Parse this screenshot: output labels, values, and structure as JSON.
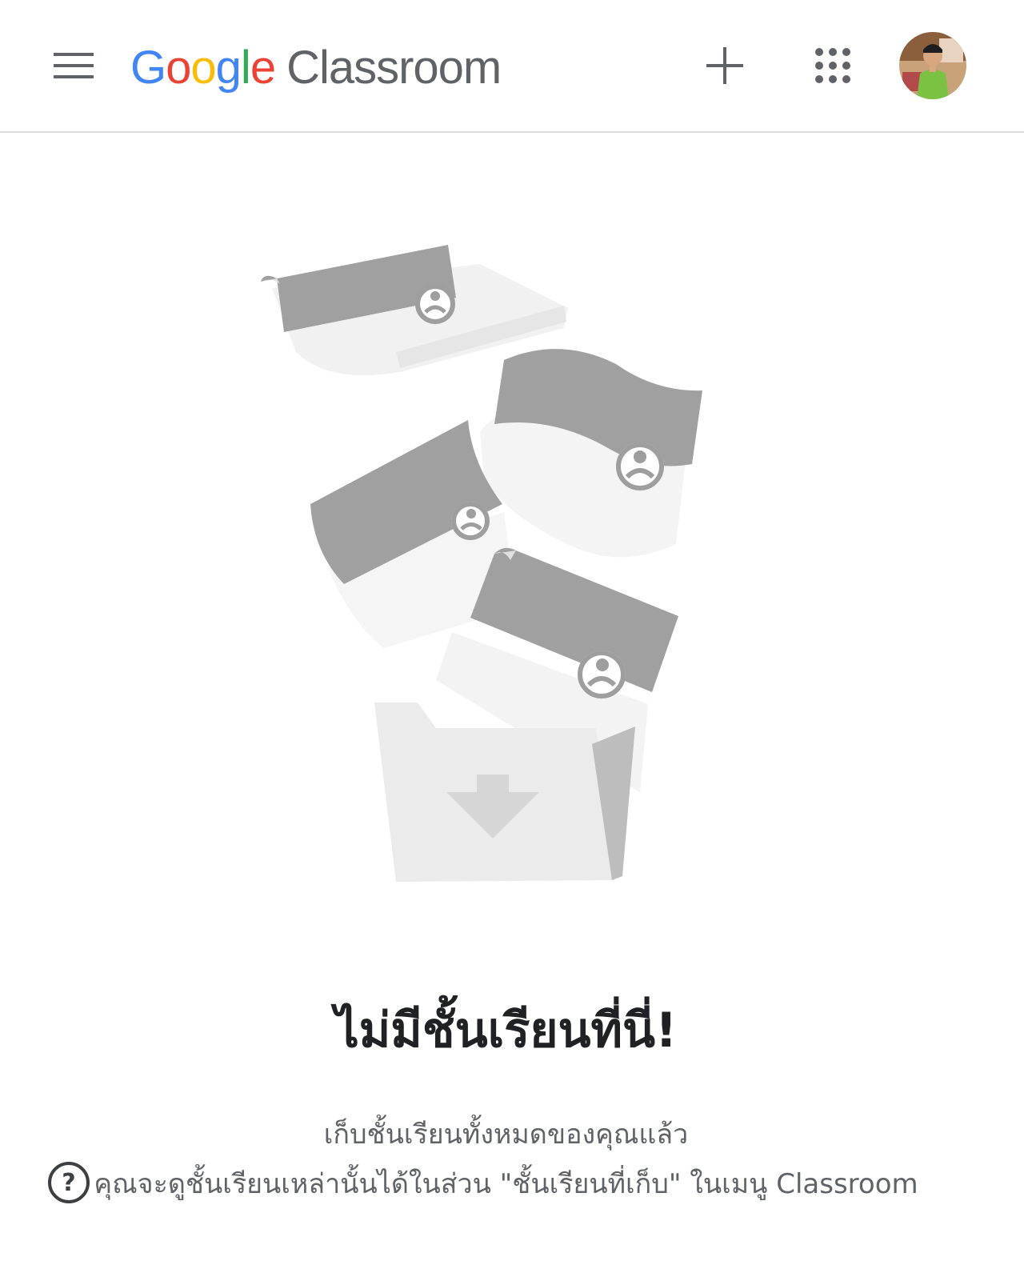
{
  "header": {
    "brand_google_letters": [
      "G",
      "o",
      "o",
      "g",
      "l",
      "e"
    ],
    "brand_product": "Classroom",
    "brand_colors": [
      "#4285F4",
      "#EA4335",
      "#FBBC05",
      "#4285F4",
      "#34A853",
      "#EA4335"
    ],
    "menu_icon": "hamburger-menu-icon",
    "add_icon": "plus-icon",
    "apps_icon": "google-apps-grid-icon",
    "avatar_icon": "user-avatar"
  },
  "empty_state": {
    "title": "ไม่มีชั้นเรียนที่นี่!",
    "line1": "เก็บชั้นเรียนทั้งหมดของคุณแล้ว",
    "line2": "คุณจะดูชั้นเรียนเหล่านั้นได้ในส่วน \"ชั้นเรียนที่เก็บ\" ในเมนู Classroom",
    "illustration": "archived-class-cards-falling-into-folder"
  },
  "help": {
    "icon": "help-question-icon",
    "label": "?"
  },
  "colors": {
    "divider": "#dadce0",
    "title_text": "#202124",
    "body_text": "#5f6368",
    "illustration_dark": "#9e9e9e",
    "illustration_light": "#eeeeee"
  }
}
